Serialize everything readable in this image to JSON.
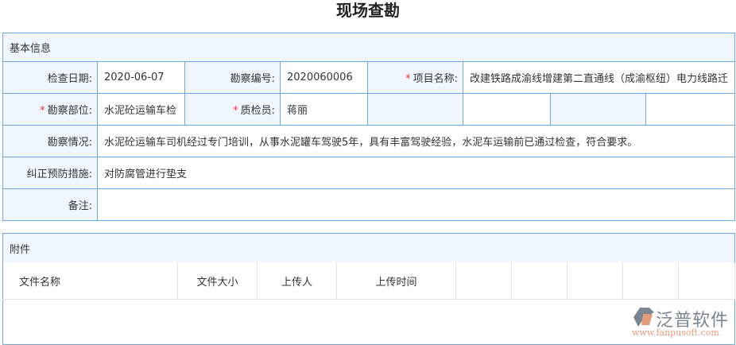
{
  "title": "现场查勘",
  "basic": {
    "header": "基本信息",
    "check_date_label": "检查日期:",
    "check_date": "2020-06-07",
    "survey_no_label": "勘察编号:",
    "survey_no": "2020060006",
    "project_label": "项目名称:",
    "project": "改建铁路成渝线增建第二直通线（成渝枢纽）电力线路迁",
    "part_label": "勘察部位:",
    "part": "水泥砼运输车检",
    "inspector_label": "质检员:",
    "inspector": "蒋丽",
    "situation_label": "勘察情况:",
    "situation": "水泥砼运输车司机经过专门培训，从事水泥罐车驾驶5年，具有丰富驾驶经验，水泥车运输前已通过检查，符合要求。",
    "measures_label": "纠正预防措施:",
    "measures": "对防腐管进行垫支",
    "remark_label": "备注:",
    "remark": "",
    "required_mark": "*"
  },
  "attachments": {
    "header": "附件",
    "columns": [
      "文件名称",
      "文件大小",
      "上传人",
      "上传时间",
      "",
      "",
      "",
      "",
      ""
    ]
  },
  "logo": {
    "name": "泛普软件",
    "url": "www.fanpusoft.com"
  }
}
